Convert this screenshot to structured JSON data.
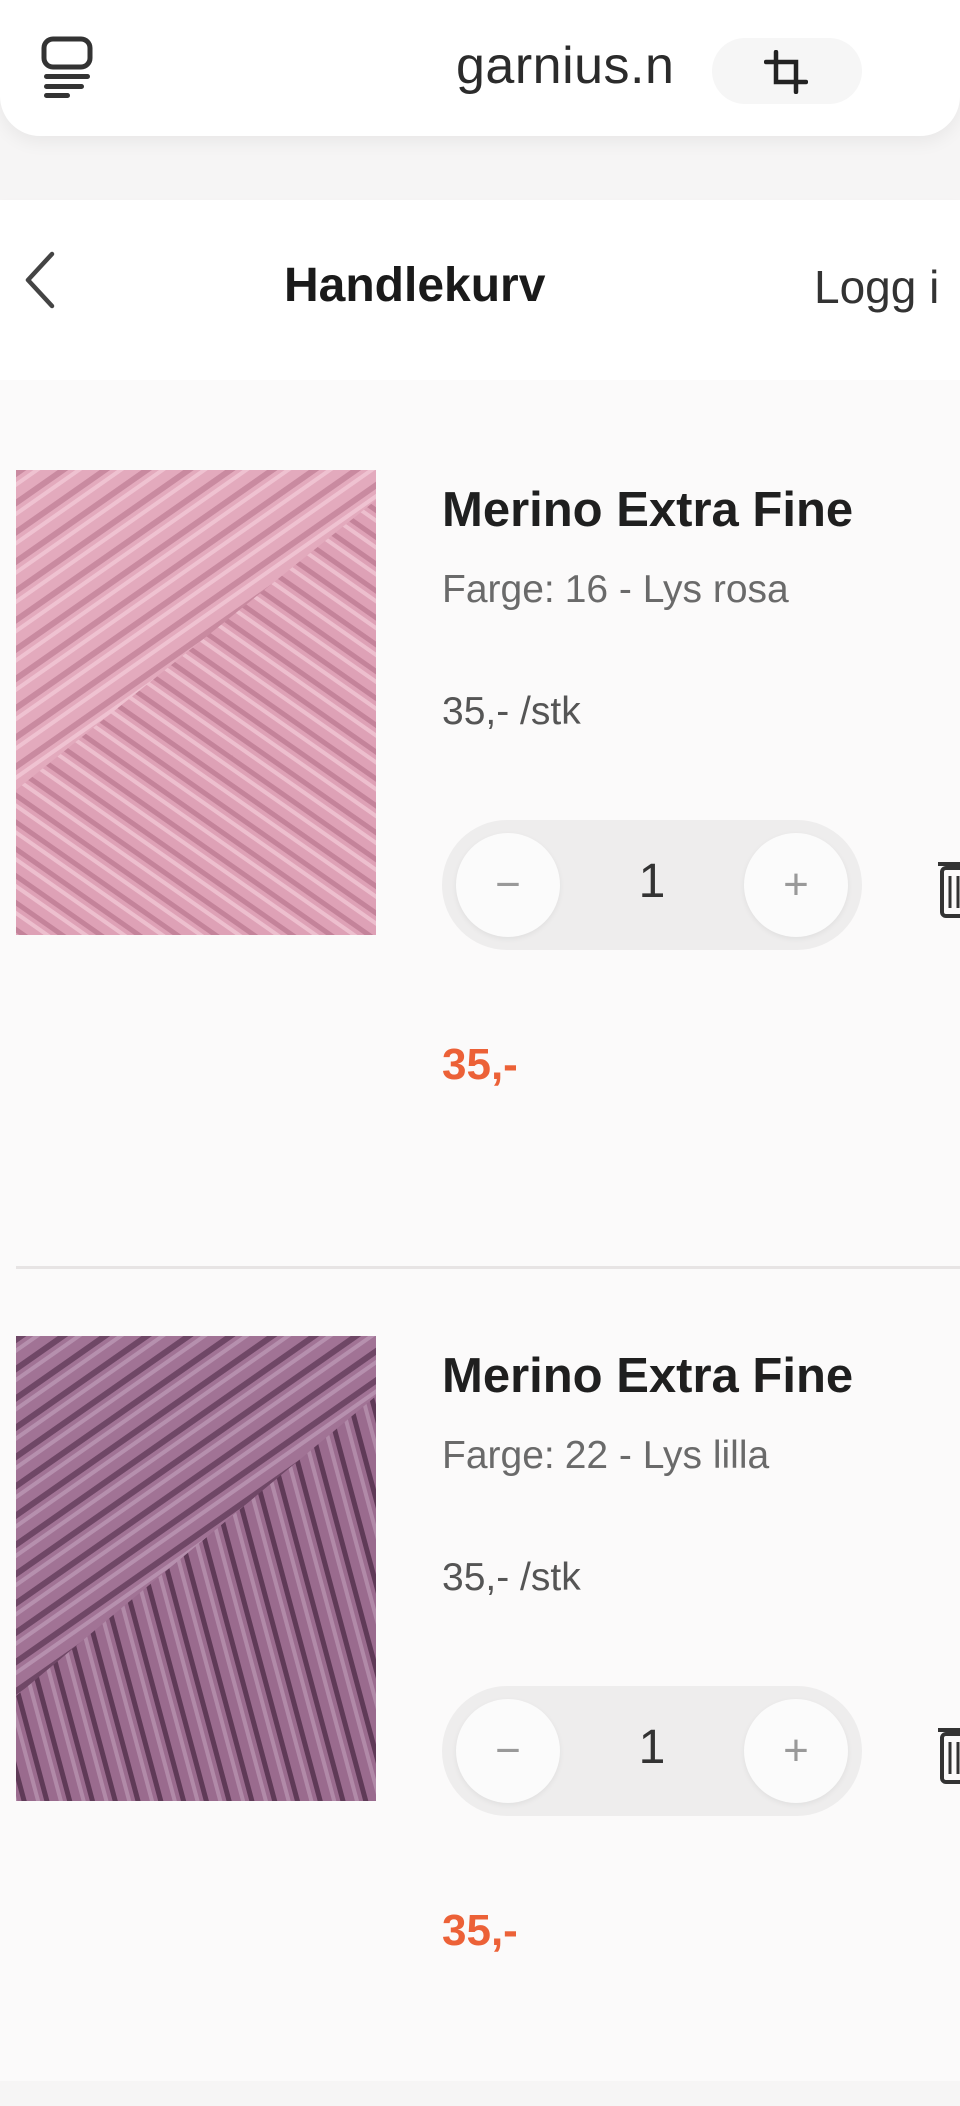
{
  "browser": {
    "url": "garnius.n",
    "tabs_icon": "tabs-icon",
    "crop_icon": "crop-icon"
  },
  "header": {
    "back_icon": "chevron-left-icon",
    "title": "Handlekurv",
    "login": "Logg i"
  },
  "cart": {
    "items": [
      {
        "name": "Merino Extra Fine",
        "color_label": "Farge:",
        "color_value": "16 - Lys rosa",
        "unit_price": "35,- /stk",
        "quantity": "1",
        "minus": "−",
        "plus": "+",
        "total": "35,-",
        "swatch_color": "#e0a6bb"
      },
      {
        "name": "Merino Extra Fine",
        "color_label": "Farge:",
        "color_value": "22 - Lys lilla",
        "unit_price": "35,- /stk",
        "quantity": "1",
        "minus": "−",
        "plus": "+",
        "total": "35,-",
        "swatch_color": "#9b6a8d"
      }
    ]
  },
  "colors": {
    "accent": "#ec6137"
  }
}
